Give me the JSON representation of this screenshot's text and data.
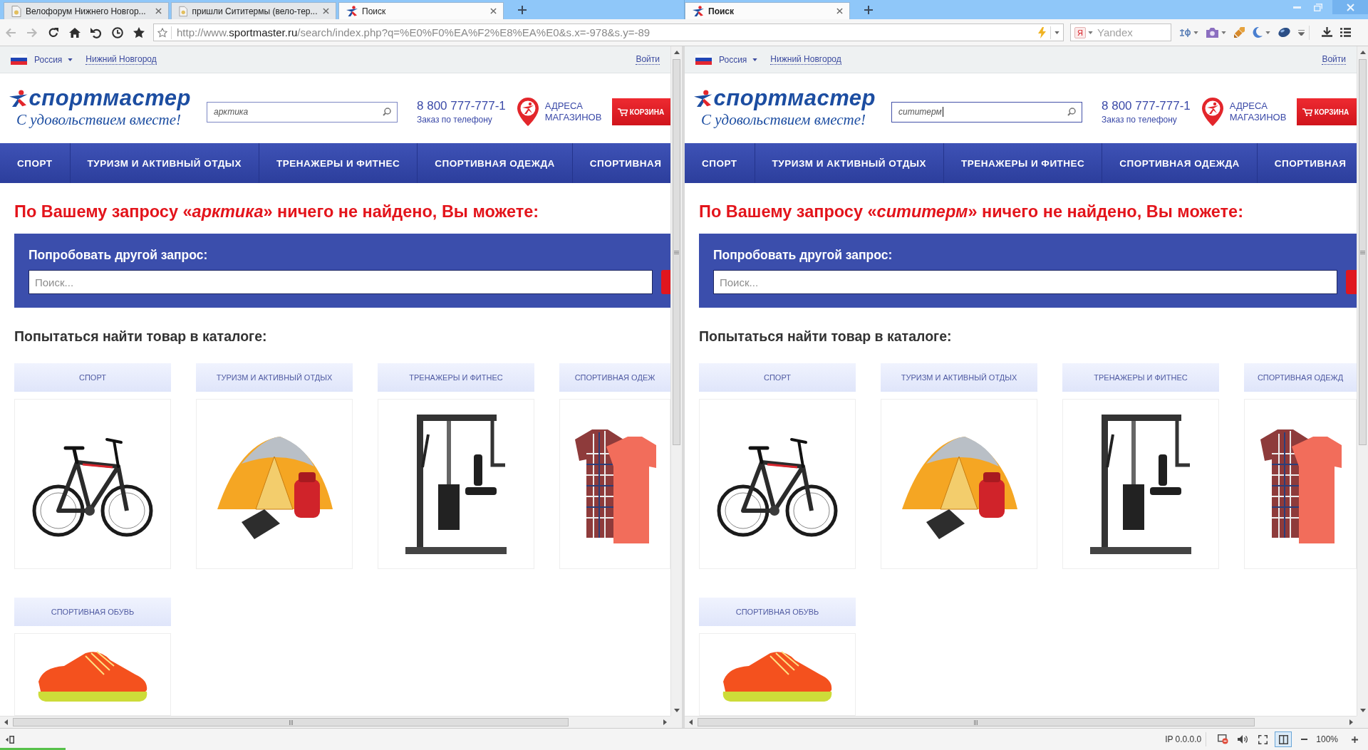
{
  "tab_strips": [
    {
      "active": false,
      "tabs": [
        {
          "title": "Велофорум Нижнего Новгор...",
          "kind": "document",
          "selected": false
        },
        {
          "title": "пришли Сититермы (вело-тер...",
          "kind": "document",
          "selected": false
        },
        {
          "title": "Поиск",
          "kind": "site",
          "selected": true
        }
      ]
    },
    {
      "active": true,
      "tabs": [
        {
          "title": "Поиск",
          "kind": "site",
          "selected": true
        }
      ]
    }
  ],
  "toolbar": {
    "back": {
      "disabled": true
    },
    "forward": {
      "disabled": true
    },
    "url": "http://www.**sportmaster.ru**/search/index.php?q=%E0%F0%EA%F2%E8%EA%E0&s.x=-978&s.y=-89",
    "search_badge": "Я",
    "search_placeholder": "Yandex"
  },
  "panes": [
    {
      "topbar": {
        "country": "Россия",
        "city": "Нижний Новгород",
        "login": "Войти"
      },
      "logo": {
        "name": "спортмастер",
        "slogan": "С удовольствием вместе!"
      },
      "search": {
        "value": "арктика",
        "focused": false
      },
      "phone": {
        "number": "8 800 777-777-1",
        "caption": "Заказ по телефону"
      },
      "stores": "АДРЕСА МАГАЗИНОВ",
      "cart": "КОРЗИНА",
      "nav": [
        "СПОРТ",
        "ТУРИЗМ И АКТИВНЫЙ ОТДЫХ",
        "ТРЕНАЖЕРЫ И ФИТНЕС",
        "СПОРТИВНАЯ ОДЕЖДА",
        "СПОРТИВНАЯ"
      ],
      "message": "По Вашему запросу «*арктика*» ничего не найдено, Вы можете:",
      "retry": {
        "title": "Попробовать другой запрос:",
        "placeholder": "Поиск..."
      },
      "catalog": {
        "title": "Попытаться найти товар в каталоге:",
        "categories": [
          {
            "label": "СПОРТ",
            "kind": "bicycle"
          },
          {
            "label": "ТУРИЗМ И АКТИВНЫЙ ОТДЫХ",
            "kind": "tent"
          },
          {
            "label": "ТРЕНАЖЕРЫ И ФИТНЕС",
            "kind": "gym"
          },
          {
            "label": "СПОРТИВНАЯ ОДЕЖ",
            "kind": "clothes"
          },
          {
            "label": "СПОРТИВНАЯ ОБУВЬ",
            "kind": "sneaker"
          }
        ]
      }
    },
    {
      "topbar": {
        "country": "Россия",
        "city": "Нижний Новгород",
        "login": "Войти"
      },
      "logo": {
        "name": "спортмастер",
        "slogan": "С удовольствием вместе!"
      },
      "search": {
        "value": "сититерм",
        "focused": true
      },
      "phone": {
        "number": "8 800 777-777-1",
        "caption": "Заказ по телефону"
      },
      "stores": "АДРЕСА МАГАЗИНОВ",
      "cart": "КОРЗИНА",
      "nav": [
        "СПОРТ",
        "ТУРИЗМ И АКТИВНЫЙ ОТДЫХ",
        "ТРЕНАЖЕРЫ И ФИТНЕС",
        "СПОРТИВНАЯ ОДЕЖДА",
        "СПОРТИВНАЯ"
      ],
      "message": "По Вашему запросу «*сититерм*» ничего не найдено, Вы можете:",
      "retry": {
        "title": "Попробовать другой запрос:",
        "placeholder": "Поиск..."
      },
      "catalog": {
        "title": "Попытаться найти товар в каталоге:",
        "categories": [
          {
            "label": "СПОРТ",
            "kind": "bicycle"
          },
          {
            "label": "ТУРИЗМ И АКТИВНЫЙ ОТДЫХ",
            "kind": "tent"
          },
          {
            "label": "ТРЕНАЖЕРЫ И ФИТНЕС",
            "kind": "gym"
          },
          {
            "label": "СПОРТИВНАЯ ОДЕЖД",
            "kind": "clothes"
          },
          {
            "label": "СПОРТИВНАЯ ОБУВЬ",
            "kind": "sneaker"
          }
        ]
      }
    }
  ],
  "status_bar": {
    "ip": "IP 0.0.0.0",
    "split_view": true,
    "zoom": "100%"
  }
}
